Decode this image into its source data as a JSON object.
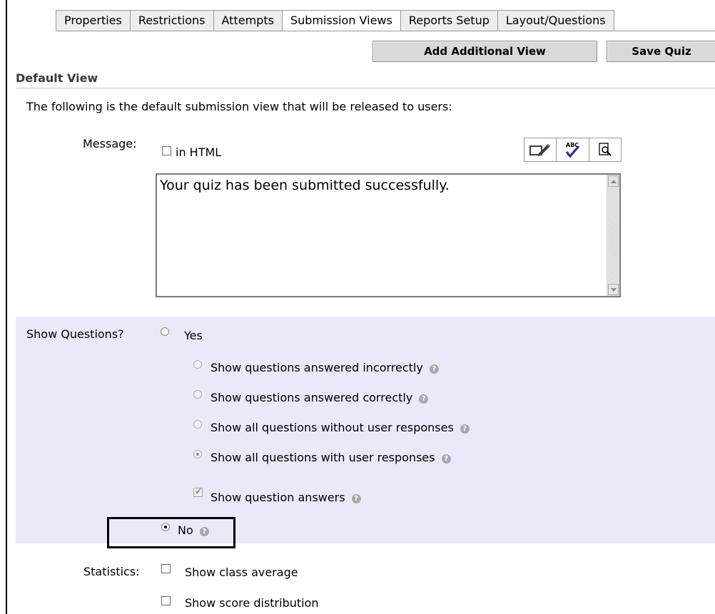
{
  "tabs": [
    {
      "label": "Properties",
      "active": false
    },
    {
      "label": "Restrictions",
      "active": false
    },
    {
      "label": "Attempts",
      "active": false
    },
    {
      "label": "Submission Views",
      "active": true
    },
    {
      "label": "Reports Setup",
      "active": false
    },
    {
      "label": "Layout/Questions",
      "active": false
    }
  ],
  "toolbar": {
    "add_view_label": "Add Additional View",
    "save_label": "Save Quiz"
  },
  "default_view": {
    "title": "Default View",
    "intro": "The following is the default submission view that will be released to users:",
    "message": {
      "label": "Message:",
      "in_html_label": "in HTML",
      "in_html_checked": false,
      "text": "Your quiz has been submitted successfully.",
      "tools": [
        "edit-html-icon",
        "spellcheck-icon",
        "preview-icon"
      ]
    },
    "show_questions": {
      "label": "Show Questions?",
      "yes_label": "Yes",
      "yes_selected": false,
      "options": [
        {
          "label": "Show questions answered incorrectly",
          "selected": false
        },
        {
          "label": "Show questions answered correctly",
          "selected": false
        },
        {
          "label": "Show all questions without user responses",
          "selected": false
        },
        {
          "label": "Show all questions with user responses",
          "selected": true
        }
      ],
      "show_answers_label": "Show question answers",
      "show_answers_checked": true,
      "no_label": "No",
      "no_selected": true
    },
    "statistics": {
      "label": "Statistics:",
      "class_average_label": "Show class average",
      "class_average_checked": false,
      "score_distribution_label": "Show score distribution",
      "score_distribution_checked": false
    }
  },
  "colors": {
    "panel_bg": "#e9e9f9",
    "button_bg": "#d9d9d9",
    "tab_bg": "#ededed"
  }
}
